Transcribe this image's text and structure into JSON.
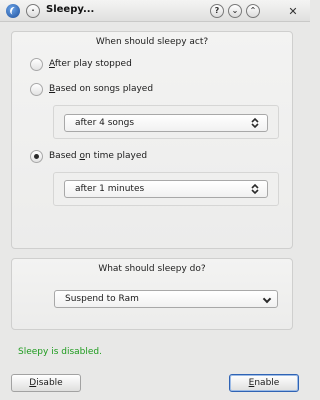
{
  "window": {
    "title": "Sleepy...",
    "app_icon": "sleepy-app-icon",
    "buttons": [
      {
        "name": "pin-icon",
        "glyph": "·"
      },
      {
        "name": "help-icon",
        "glyph": "?"
      },
      {
        "name": "minimize-icon",
        "glyph": "⌄"
      },
      {
        "name": "maximize-icon",
        "glyph": "⌃"
      },
      {
        "name": "close-icon",
        "glyph": "✕"
      }
    ]
  },
  "when_group": {
    "title": "When should sleepy act?",
    "options": [
      {
        "pre": "",
        "mnemonic": "A",
        "post": "fter play stopped",
        "checked": false
      },
      {
        "pre": "",
        "mnemonic": "B",
        "post": "ased on songs played",
        "checked": false
      },
      {
        "pre": "Based ",
        "mnemonic": "o",
        "post": "n time played",
        "checked": true
      }
    ],
    "songs_value": "after 4 songs",
    "time_value": "after 1 minutes"
  },
  "what_group": {
    "title": "What should sleepy do?",
    "action_value": "Suspend to Ram"
  },
  "status": {
    "text": "Sleepy is disabled.",
    "color": "#1f9c1f"
  },
  "footer": {
    "disable": {
      "mnemonic": "D",
      "rest": "isable"
    },
    "enable": {
      "mnemonic": "E",
      "rest": "nable"
    }
  }
}
